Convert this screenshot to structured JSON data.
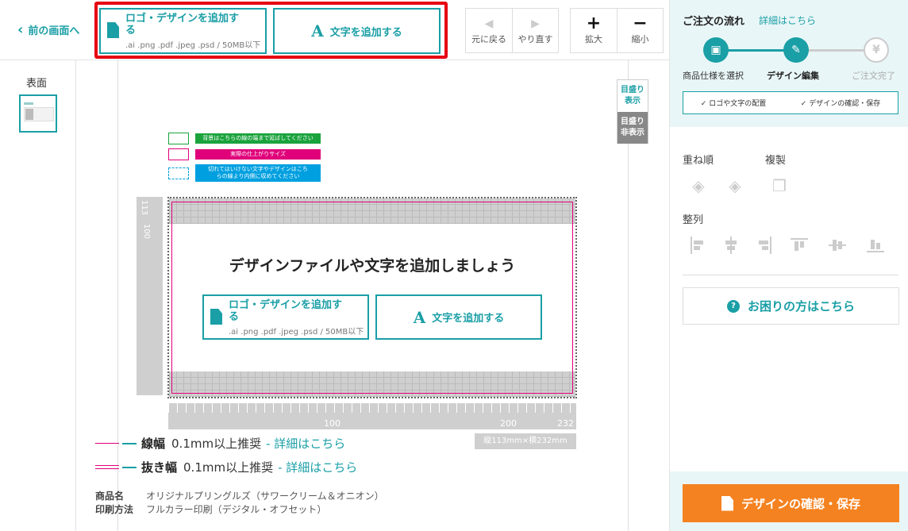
{
  "topbar": {
    "back_label": "前の画面へ",
    "logo_button": {
      "label": "ロゴ・デザインを追加する",
      "formats": ".ai .png .pdf .jpeg .psd / 50MB以下"
    },
    "text_button_label": "文字を追加する",
    "text_button_glyph": "A",
    "undo_label": "元に戻る",
    "redo_label": "やり直す",
    "zoom_in_label": "拡大",
    "zoom_out_label": "縮小"
  },
  "pages": {
    "face_label": "表面"
  },
  "scale_toggle": {
    "show_line1": "目盛り",
    "show_line2": "表示",
    "hide_line1": "目盛り",
    "hide_line2": "非表示"
  },
  "legend": [
    {
      "text": "背景はこちらの線の端まで延ばしてください",
      "color": "#1aa33c"
    },
    {
      "text": "実際の仕上がりサイズ",
      "color": "#e0007a"
    },
    {
      "text": "切れてはいけない文字やデザインはこちらの線より内側に収めてください",
      "color": "#00a0e0"
    }
  ],
  "canvas": {
    "cta_title": "デザインファイルや文字を追加しましょう",
    "ruler_v": [
      "113",
      "100"
    ],
    "ruler_h": [
      "100",
      "200",
      "232"
    ],
    "size_label": "縦113mm×横232mm"
  },
  "specs": {
    "line_width": {
      "label": "線幅",
      "value": "0.1mm以上推奨",
      "link": "- 詳細はこちら"
    },
    "knockout_width": {
      "label": "抜き幅",
      "value": "0.1mm以上推奨",
      "link": "- 詳細はこちら"
    }
  },
  "meta": {
    "product_key": "商品名",
    "product_value": "オリジナルプリングルズ（サワークリーム＆オニオン）",
    "print_key": "印刷方法",
    "print_value": "フルカラー印刷（デジタル・オフセット）"
  },
  "panel": {
    "flow_title": "ご注文の流れ",
    "flow_detail": "詳細はこちら",
    "steps": [
      {
        "label": "商品仕様を選択",
        "icon": "gift-icon",
        "state": "done"
      },
      {
        "label": "デザイン編集",
        "icon": "pencil-icon",
        "state": "current"
      },
      {
        "label": "ご注文完了",
        "icon": "yen-icon",
        "state": "pending"
      }
    ],
    "substeps": [
      "✓ ロゴや文字の配置",
      "✓ デザインの確認・保存"
    ],
    "layer_label": "重ね順",
    "duplicate_label": "複製",
    "align_label": "整列",
    "help_label": "お困りの方はこちら",
    "save_label": "デザインの確認・保存"
  },
  "colors": {
    "accent": "#1a9fa6",
    "highlight": "#e60012",
    "save": "#f58220",
    "cut": "#e0007a"
  }
}
